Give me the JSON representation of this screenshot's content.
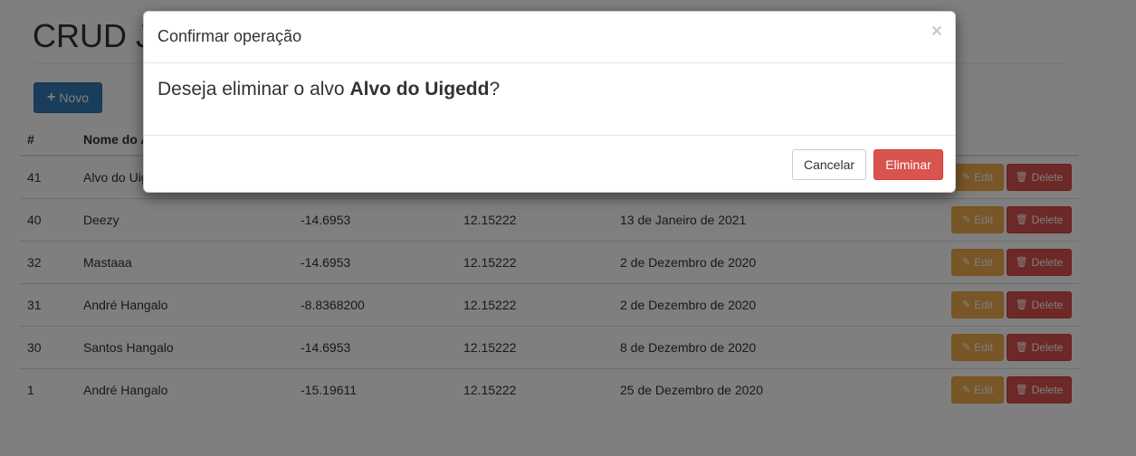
{
  "page": {
    "title": "CRUD Jogo",
    "new_button": {
      "icon": "plus-icon",
      "label": "Novo"
    }
  },
  "table": {
    "columns": [
      "#",
      "Nome do Alvo",
      "",
      "",
      "",
      ""
    ],
    "rows": [
      {
        "id": "41",
        "name": "Alvo do Uigedd",
        "lat": "",
        "lon": "",
        "date": ""
      },
      {
        "id": "40",
        "name": "Deezy",
        "lat": "-14.6953",
        "lon": "12.15222",
        "date": "13 de Janeiro de 2021"
      },
      {
        "id": "32",
        "name": "Mastaaa",
        "lat": "-14.6953",
        "lon": "12.15222",
        "date": "2 de Dezembro de 2020"
      },
      {
        "id": "31",
        "name": "André Hangalo",
        "lat": "-8.8368200",
        "lon": "12.15222",
        "date": "2 de Dezembro de 2020"
      },
      {
        "id": "30",
        "name": "Santos Hangalo",
        "lat": "-14.6953",
        "lon": "12.15222",
        "date": "8 de Dezembro de 2020"
      },
      {
        "id": "1",
        "name": "André Hangalo",
        "lat": "-15.19611",
        "lon": "12.15222",
        "date": "25 de Dezembro de 2020"
      }
    ],
    "actions": {
      "edit_label": "Edit",
      "edit_icon": "pencil-icon",
      "delete_label": "Delete",
      "delete_icon": "trash-icon"
    }
  },
  "modal": {
    "title": "Confirmar operação",
    "close_symbol": "×",
    "message_prefix": "Deseja eliminar o alvo ",
    "message_target": "Alvo do Uigedd",
    "message_suffix": "?",
    "cancel_label": "Cancelar",
    "confirm_label": "Eliminar"
  },
  "colors": {
    "primary": "#337ab7",
    "warning": "#f0ad4e",
    "danger": "#d9534f",
    "backdrop": "rgba(0,0,0,0.5)"
  }
}
